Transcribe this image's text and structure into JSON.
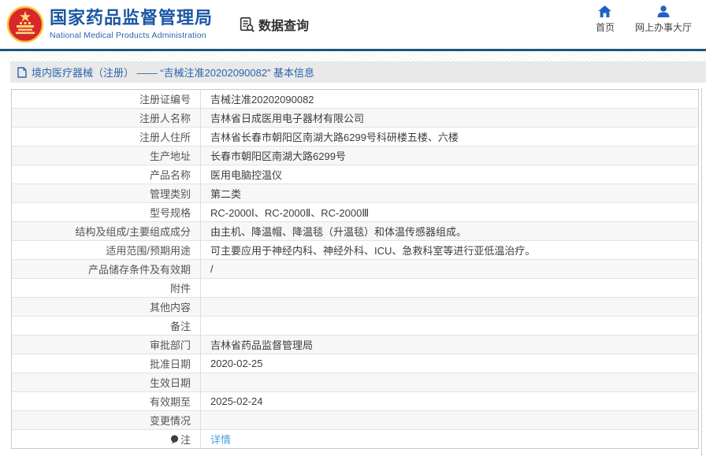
{
  "header": {
    "title": "国家药品监督管理局",
    "subtitle": "National Medical Products Administration",
    "data_query_label": "数据查询",
    "nav_home": "首页",
    "nav_hall": "网上办事大厅"
  },
  "breadcrumb": {
    "text": "境内医疗器械（注册） —— “吉械注准20202090082” 基本信息"
  },
  "table": {
    "rows": [
      {
        "label": "注册证编号",
        "value": "吉械注准20202090082"
      },
      {
        "label": "注册人名称",
        "value": "吉林省日成医用电子器材有限公司"
      },
      {
        "label": "注册人住所",
        "value": "吉林省长春市朝阳区南湖大路6299号科研楼五楼、六楼"
      },
      {
        "label": "生产地址",
        "value": "长春市朝阳区南湖大路6299号"
      },
      {
        "label": "产品名称",
        "value": "医用电脑控温仪"
      },
      {
        "label": "管理类别",
        "value": "第二类"
      },
      {
        "label": "型号规格",
        "value": "RC-2000Ⅰ、RC-2000Ⅱ、RC-2000Ⅲ"
      },
      {
        "label": "结构及组成/主要组成成分",
        "value": "由主机、降温帽、降温毯（升温毯）和体温传感器组成。"
      },
      {
        "label": "适用范围/预期用途",
        "value": "可主要应用于神经内科、神经外科、ICU、急救科室等进行亚低温治疗。"
      },
      {
        "label": "产品储存条件及有效期",
        "value": "/"
      },
      {
        "label": "附件",
        "value": ""
      },
      {
        "label": "其他内容",
        "value": ""
      },
      {
        "label": "备注",
        "value": ""
      },
      {
        "label": "审批部门",
        "value": "吉林省药品监督管理局"
      },
      {
        "label": "批准日期",
        "value": "2020-02-25"
      },
      {
        "label": "生效日期",
        "value": ""
      },
      {
        "label": "有效期至",
        "value": "2025-02-24"
      },
      {
        "label": "变更情况",
        "value": ""
      },
      {
        "label": "注",
        "value": "详情"
      }
    ]
  },
  "colors": {
    "brand_blue": "#1c57a5",
    "nav_icon_blue": "#2161c1",
    "header_divider_blue": "#1d5680",
    "breadcrumb_text_blue": "#2a64ae",
    "link_blue": "#4da0e0",
    "row_stripe": "#f7f7f7",
    "emblem_red": "#d8262c",
    "emblem_gold": "#f5c636"
  }
}
